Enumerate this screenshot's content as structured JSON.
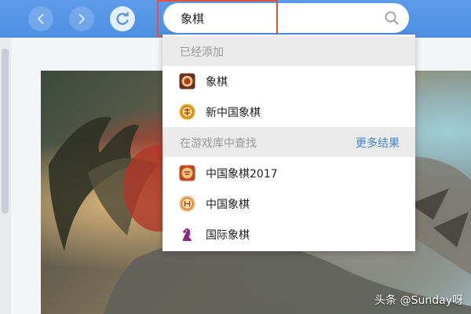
{
  "toolbar": {
    "search": {
      "value": "象棋"
    }
  },
  "dropdown": {
    "added_section": {
      "title": "已经添加",
      "items": [
        {
          "label": "象棋",
          "icon": "xiangqi-app-icon"
        },
        {
          "label": "新中国象棋",
          "icon": "xin-zhongguo-xiangqi-app-icon"
        }
      ]
    },
    "library_section": {
      "title": "在游戏库中查找",
      "more_label": "更多结果",
      "items": [
        {
          "label": "中国象棋2017",
          "icon": "zhongguo-xiangqi-2017-app-icon"
        },
        {
          "label": "中国象棋",
          "icon": "zhongguo-xiangqi-app-icon"
        },
        {
          "label": "国际象棋",
          "icon": "chess-knight-app-icon"
        }
      ]
    }
  },
  "watermark": "头条 @Sunday呀",
  "colors": {
    "topbar": "#4f8fe2",
    "highlight": "#e0533b",
    "link": "#3e86d6"
  }
}
